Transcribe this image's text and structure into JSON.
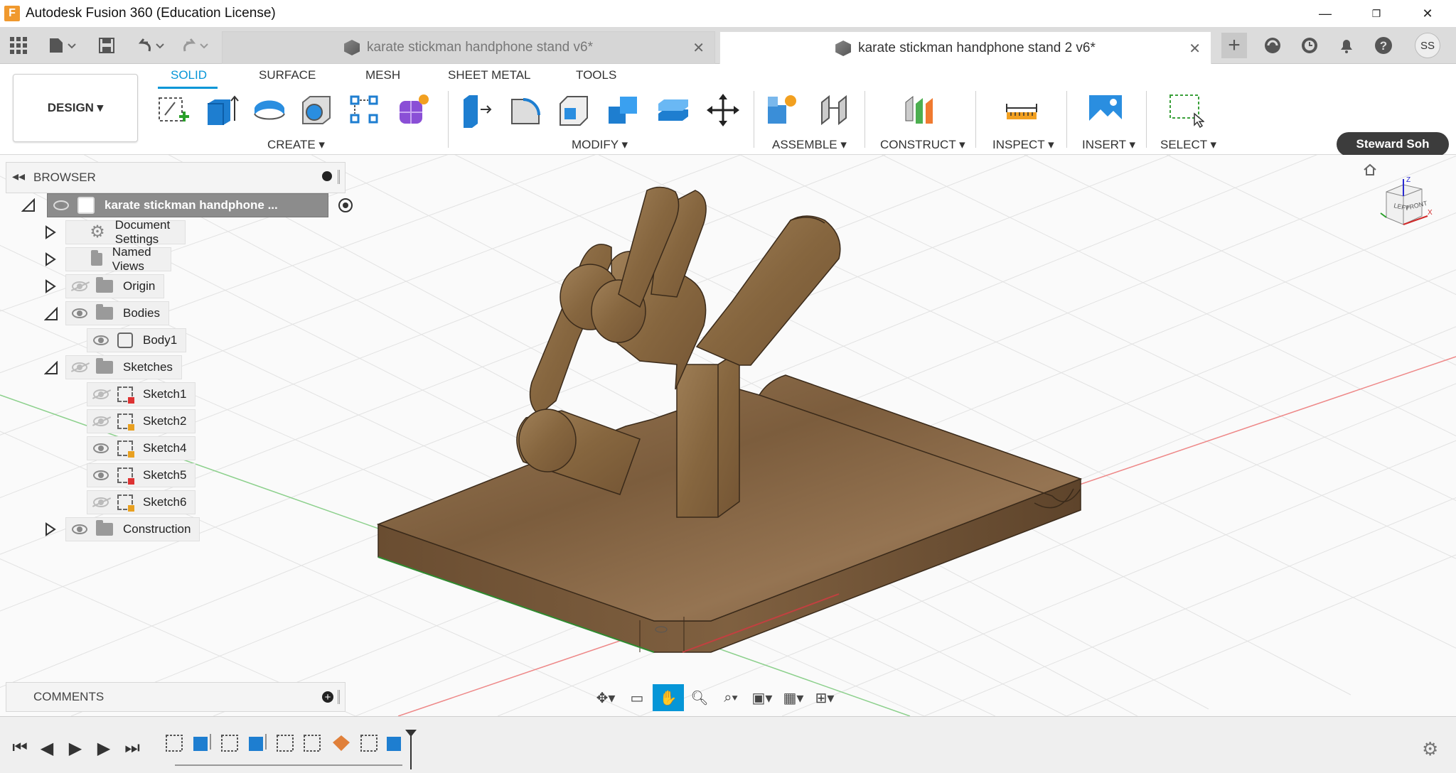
{
  "app": {
    "title": "Autodesk Fusion 360 (Education License)",
    "logo_letter": "F"
  },
  "window_controls": {
    "minimize": "—",
    "restore": "❐",
    "close": "✕"
  },
  "tabs": [
    {
      "label": "karate stickman handphone stand v6*",
      "active": false
    },
    {
      "label": "karate stickman handphone stand 2 v6*",
      "active": true
    }
  ],
  "user": {
    "initials": "SS",
    "name": "Steward Soh"
  },
  "ribbon": {
    "workspace": "DESIGN ▾",
    "tabs": [
      "SOLID",
      "SURFACE",
      "MESH",
      "SHEET METAL",
      "TOOLS"
    ],
    "groups": [
      "CREATE ▾",
      "MODIFY ▾",
      "ASSEMBLE ▾",
      "CONSTRUCT ▾",
      "INSPECT ▾",
      "INSERT ▾",
      "SELECT ▾"
    ]
  },
  "browser": {
    "header": "BROWSER",
    "root": "karate stickman handphone ...",
    "items": [
      {
        "label": "Document Settings",
        "icon": "gear-icon"
      },
      {
        "label": "Named Views",
        "icon": "folder-icon"
      },
      {
        "label": "Origin",
        "icon": "folder-icon"
      },
      {
        "label": "Bodies",
        "icon": "folder-icon"
      },
      {
        "label": "Body1",
        "icon": "body-icon"
      },
      {
        "label": "Sketches",
        "icon": "folder-icon"
      },
      {
        "label": "Sketch1",
        "icon": "sketch-icon"
      },
      {
        "label": "Sketch2",
        "icon": "sketch-icon"
      },
      {
        "label": "Sketch4",
        "icon": "sketch-icon"
      },
      {
        "label": "Sketch5",
        "icon": "sketch-icon"
      },
      {
        "label": "Sketch6",
        "icon": "sketch-icon"
      },
      {
        "label": "Construction",
        "icon": "folder-icon"
      }
    ]
  },
  "comments": {
    "header": "COMMENTS"
  },
  "viewcube": {
    "left": "LEFT",
    "front": "FRONT",
    "z": "Z",
    "x": "X"
  },
  "colors": {
    "accent": "#0696d7",
    "wood": "#8a6b47",
    "axis_red": "#e06060",
    "axis_green": "#60c060"
  }
}
